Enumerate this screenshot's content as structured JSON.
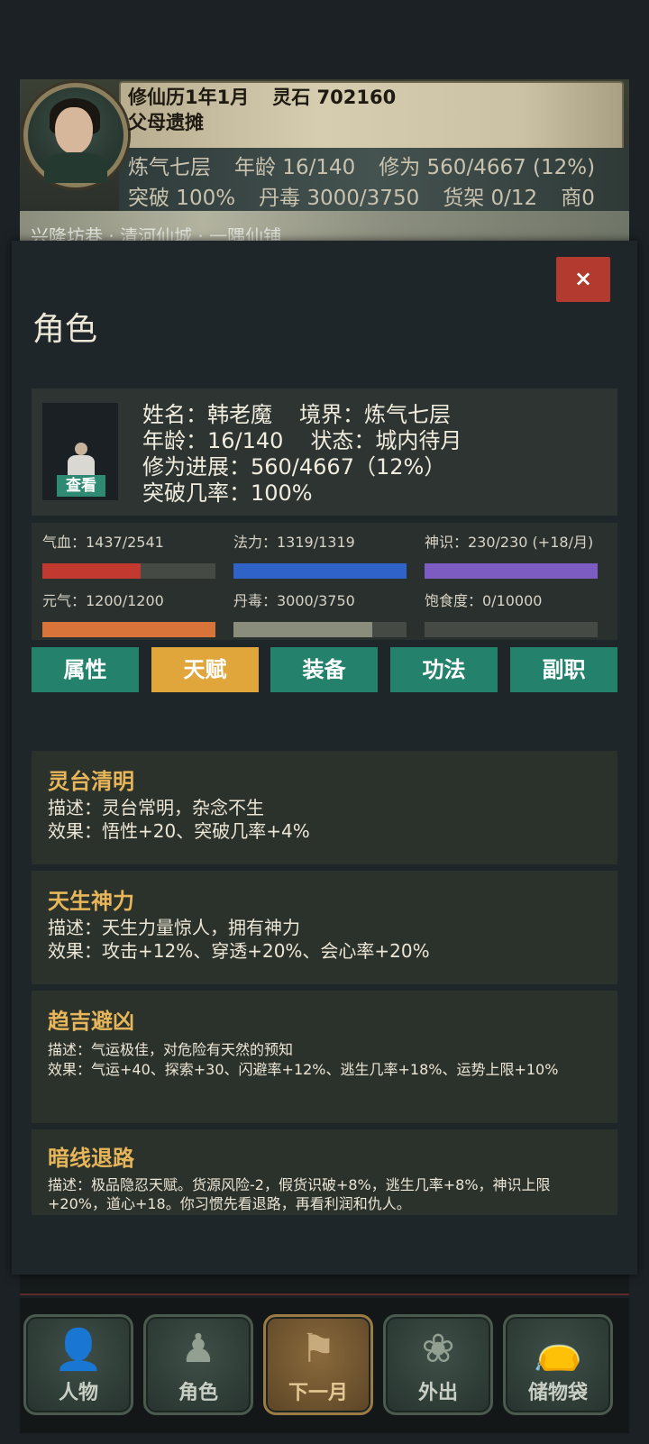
{
  "header": {
    "date": "修仙历1年1月",
    "spirit_stone": "灵石 702160",
    "location": "父母遗摊",
    "realm": "炼气七层",
    "age": "年龄 16/140",
    "cultivation": "修为 560/4667 (12%)",
    "breakthrough": "突破 100%",
    "pill_toxin": "丹毒 3000/3750",
    "shelf": "货架 0/12",
    "shop": "商0"
  },
  "background_strip_text": "兴隆坊巷 · 清河仙城 · 一隅仙铺",
  "modal": {
    "close_label": "×",
    "title": "角色",
    "profile": {
      "name_label": "姓名：韩老魔",
      "realm_label": "境界：炼气七层",
      "age_label": "年龄：16/140",
      "status_label": "状态：城内待月",
      "progress_label": "修为进展：560/4667（12%）",
      "breakthrough_label": "突破几率：100%",
      "view_button": "查看"
    },
    "stats": [
      {
        "label": "气血：1437/2541",
        "fraction": 0.566,
        "color": "#c23a2f"
      },
      {
        "label": "法力：1319/1319",
        "fraction": 1.0,
        "color": "#2f63c7"
      },
      {
        "label": "神识：230/230 (+18/月)",
        "fraction": 1.0,
        "color": "#7d5cc1"
      },
      {
        "label": "元气：1200/1200",
        "fraction": 1.0,
        "color": "#d8733a"
      },
      {
        "label": "丹毒：3000/3750",
        "fraction": 0.8,
        "color": "#8a8c7c"
      },
      {
        "label": "饱食度：0/10000",
        "fraction": 0.0,
        "color": "#6b6f66"
      }
    ],
    "tabs": [
      {
        "label": "属性",
        "active": false
      },
      {
        "label": "天赋",
        "active": true
      },
      {
        "label": "装备",
        "active": false
      },
      {
        "label": "功法",
        "active": false
      },
      {
        "label": "副职",
        "active": false
      }
    ],
    "talents": [
      {
        "name": "灵台清明",
        "desc": "描述：灵台常明，杂念不生",
        "effect": "效果：悟性+20、突破几率+4%"
      },
      {
        "name": "天生神力",
        "desc": "描述：天生力量惊人，拥有神力",
        "effect": "效果：攻击+12%、穿透+20%、会心率+20%"
      },
      {
        "name": "趋吉避凶",
        "desc": "描述：气运极佳，对危险有天然的预知",
        "effect": "效果：气运+40、探索+30、闪避率+12%、逃生几率+18%、运势上限+10%"
      },
      {
        "name": "暗线退路",
        "desc": "描述：极品隐忍天赋。货源风险-2，假货识破+8%，逃生几率+8%，神识上限+20%，道心+18。你习惯先看退路，再看利润和仇人。",
        "effect": ""
      }
    ]
  },
  "bottom_nav": [
    {
      "label": "人物",
      "icon": "person-icon",
      "active": false
    },
    {
      "label": "角色",
      "icon": "character-icon",
      "active": false
    },
    {
      "label": "下一月",
      "icon": "flag-icon",
      "active": true
    },
    {
      "label": "外出",
      "icon": "lotus-icon",
      "active": false
    },
    {
      "label": "储物袋",
      "icon": "bag-icon",
      "active": false
    }
  ]
}
